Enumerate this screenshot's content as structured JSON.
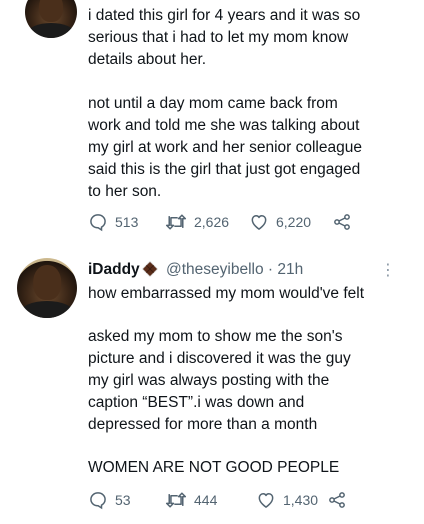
{
  "tweets": [
    {
      "paragraphs": [
        "i dated this girl for 4 years and it was so\nserious that i had to let my mom know\ndetails about her.",
        "not until a day mom came back from\nwork and told me she was talking about\nmy girl at work and her senior colleague\nsaid this is the girl that just got engaged\nto her son."
      ],
      "replies": "513",
      "retweets": "2,626",
      "likes": "6,220"
    },
    {
      "author": {
        "name": "iDaddy",
        "name_emoji": "chocolate-bar-icon",
        "handle": "@theseyibello",
        "time": "· 21h"
      },
      "paragraphs": [
        "how embarrassed my mom would've felt",
        "asked my mom to show me the son's\npicture and i discovered it was the guy\nmy girl was always posting with the\ncaption “BEST”.i was down and\ndepressed for more than a month",
        "WOMEN ARE NOT GOOD PEOPLE"
      ],
      "replies": "53",
      "retweets": "444",
      "likes": "1,430"
    }
  ],
  "colors": {
    "text": "#0f1419",
    "muted": "#536471"
  }
}
